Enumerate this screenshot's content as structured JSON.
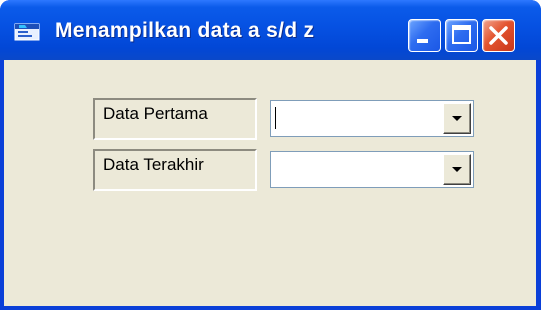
{
  "window": {
    "title": "Menampilkan data a s/d z",
    "controls": [
      "minimize-icon",
      "maximize-icon",
      "close-icon"
    ],
    "colors": {
      "titlebar": "#0651e2",
      "client": "#ece9d8",
      "close": "#e3542f"
    }
  },
  "form": {
    "first_label": "Data Pertama",
    "first_value": "",
    "last_label": "Data Terakhir",
    "last_value": ""
  }
}
